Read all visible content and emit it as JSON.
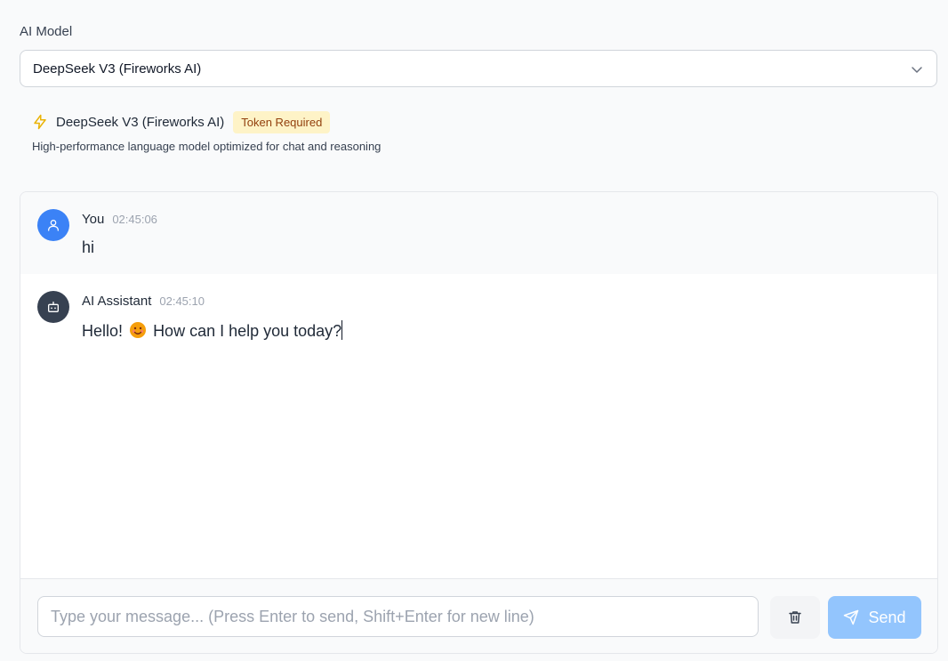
{
  "model_picker": {
    "label": "AI Model",
    "selected": "DeepSeek V3 (Fireworks AI)",
    "chevron_icon": "chevron-down-icon"
  },
  "model_info": {
    "icon": "lightning-icon",
    "name": "DeepSeek V3 (Fireworks AI)",
    "badge": "Token Required",
    "description": "High-performance language model optimized for chat and reasoning"
  },
  "messages": [
    {
      "sender": "You",
      "time": "02:45:06",
      "text": "hi",
      "avatar_icon": "user-icon"
    },
    {
      "sender": "AI Assistant",
      "time": "02:45:10",
      "text_before": "Hello!",
      "emoji": "😊",
      "text_after": "How can I help you today?",
      "avatar_icon": "bot-icon"
    }
  ],
  "composer": {
    "placeholder": "Type your message... (Press Enter to send, Shift+Enter for new line)",
    "value": "",
    "clear_icon": "trash-icon",
    "send_label": "Send",
    "send_icon": "send-icon"
  },
  "colors": {
    "accent": "#3b82f6",
    "send_disabled": "#93c5fd",
    "badge_bg": "#fef3c7",
    "badge_text": "#92400e",
    "bolt": "#eab308",
    "bot_avatar": "#374151"
  }
}
